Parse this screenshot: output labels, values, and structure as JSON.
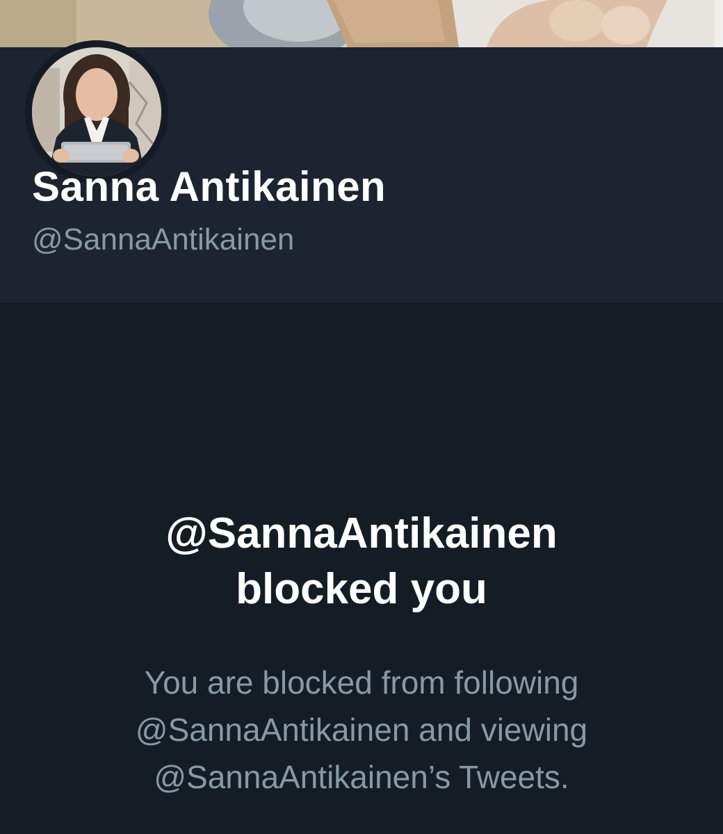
{
  "profile": {
    "display_name": "Sanna Antikainen",
    "handle": "@SannaAntikainen"
  },
  "blocked": {
    "title_line1": "@SannaAntikainen",
    "title_line2": "blocked you",
    "description_line1": "You are blocked from following",
    "description_line2": "@SannaAntikainen and viewing",
    "description_line3": "@SannaAntikainen’s Tweets."
  },
  "colors": {
    "header_background": "#1b2430",
    "body_background": "#141d26",
    "primary_text": "#ffffff",
    "secondary_text": "#8899a6"
  }
}
